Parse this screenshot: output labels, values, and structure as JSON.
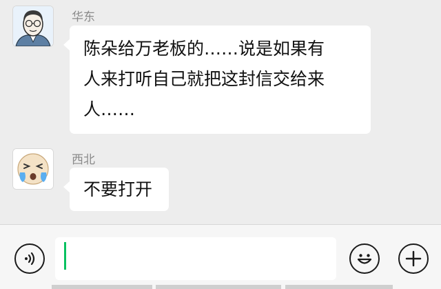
{
  "messages": [
    {
      "sender": "华东",
      "avatar_icon": "cartoon-man-with-glasses-avatar",
      "lines": [
        "陈朵给万老板的……说是如果有",
        "人来打听自己就把这封信交给来",
        "人……"
      ]
    },
    {
      "sender": "西北",
      "avatar_icon": "crying-laughing-face-avatar",
      "lines": [
        "不要打开"
      ]
    }
  ],
  "input_bar": {
    "voice_icon": "voice-icon",
    "input_value": "",
    "emoji_icon": "emoji-icon",
    "plus_icon": "plus-icon"
  },
  "colors": {
    "chat_background": "#ededed",
    "bubble": "#ffffff",
    "cursor": "#07c160",
    "sender_name": "#8a8a8a"
  }
}
